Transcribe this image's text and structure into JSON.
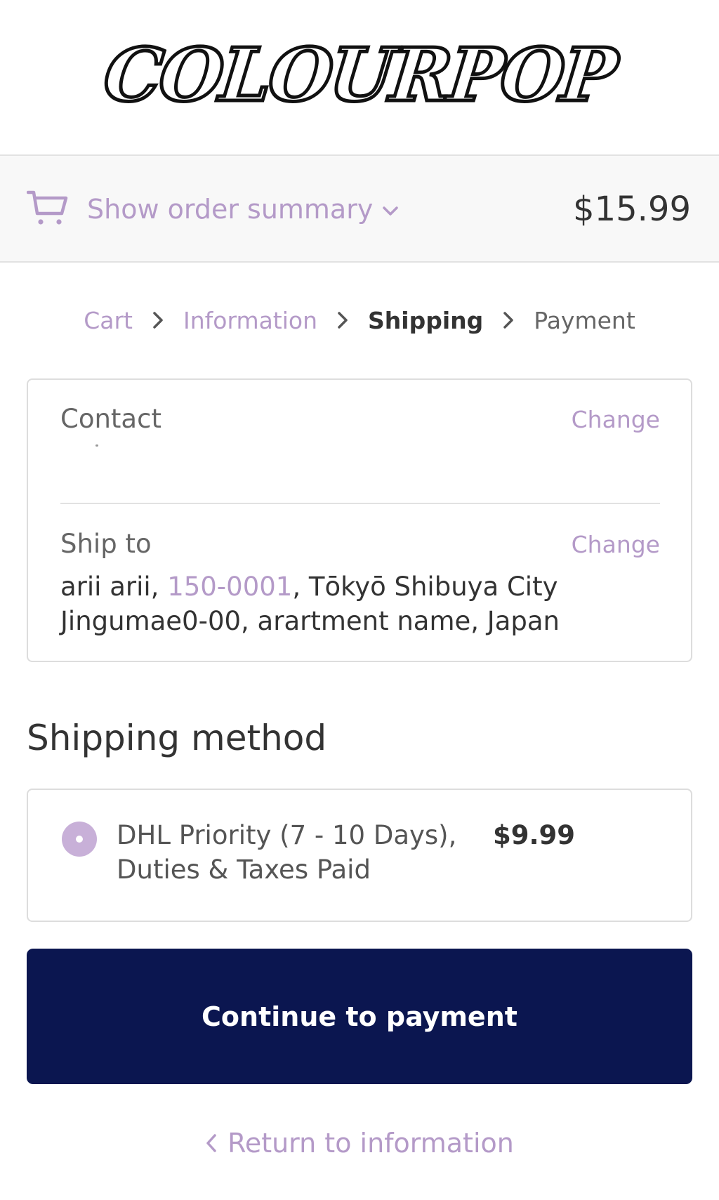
{
  "brand": {
    "logo_text": "COLOURPOP"
  },
  "order_summary": {
    "toggle_label": "Show order summary",
    "total": "$15.99",
    "icon": "cart-icon"
  },
  "breadcrumb": {
    "items": [
      {
        "label": "Cart",
        "state": "link"
      },
      {
        "label": "Information",
        "state": "link"
      },
      {
        "label": "Shipping",
        "state": "current"
      },
      {
        "label": "Payment",
        "state": "inactive"
      }
    ]
  },
  "review": {
    "contact": {
      "label": "Contact",
      "change_label": "Change"
    },
    "ship_to": {
      "label": "Ship to",
      "change_label": "Change",
      "name": "arii arii, ",
      "postal_code": "150-0001",
      "line1_rest": ", Tōkyō Shibuya City",
      "line2": "Jingumae0-00, arartment name, Japan"
    }
  },
  "shipping_method": {
    "title": "Shipping method",
    "options": [
      {
        "name": "DHL Priority (7 - 10 Days), Duties & Taxes Paid",
        "price": "$9.99",
        "selected": true
      }
    ]
  },
  "actions": {
    "continue_label": "Continue to payment",
    "return_label": "Return to information"
  },
  "colors": {
    "accent": "#b49ac8",
    "primary_button": "#0b1650",
    "text": "#333333",
    "muted_text": "#666666",
    "border": "#dddddd",
    "summary_bg": "#f8f8f8"
  }
}
